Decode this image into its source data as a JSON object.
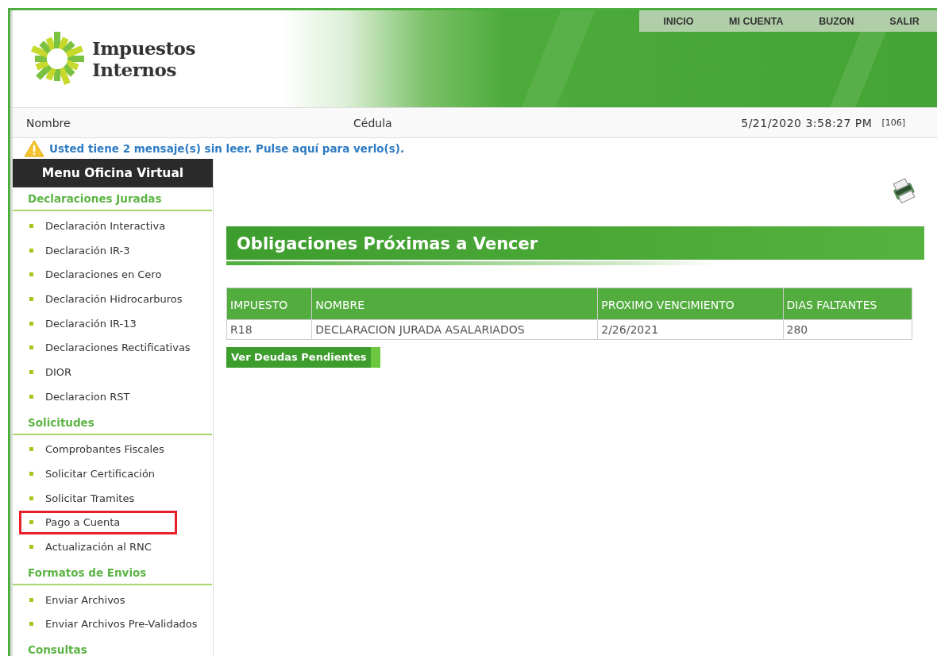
{
  "header": {
    "logo_lines": [
      "Impuestos",
      "Internos"
    ],
    "nav": [
      "INICIO",
      "MI CUENTA",
      "BUZON",
      "SALIR"
    ]
  },
  "info_bar": {
    "name_label": "Nombre",
    "id_label": "Cédula",
    "datetime": "5/21/2020 3:58:27 PM",
    "code": "[106]"
  },
  "alert": "Usted tiene 2 mensaje(s) sin leer. Pulse aquí para verlo(s).",
  "sidebar": {
    "title": "Menu Oficina Virtual",
    "sections": [
      {
        "title": "Declaraciones Juradas",
        "items": [
          {
            "label": "Declaración Interactiva",
            "highlighted": false
          },
          {
            "label": "Declaración IR-3",
            "highlighted": false
          },
          {
            "label": "Declaraciones en Cero",
            "highlighted": false
          },
          {
            "label": "Declaración Hidrocarburos",
            "highlighted": false
          },
          {
            "label": "Declaración IR-13",
            "highlighted": false
          },
          {
            "label": "Declaraciones Rectificativas",
            "highlighted": false
          },
          {
            "label": "DIOR",
            "highlighted": false
          },
          {
            "label": "Declaracion RST",
            "highlighted": false
          }
        ]
      },
      {
        "title": "Solicitudes",
        "items": [
          {
            "label": "Comprobantes Fiscales",
            "highlighted": false
          },
          {
            "label": "Solicitar Certificación",
            "highlighted": false
          },
          {
            "label": "Solicitar Tramites",
            "highlighted": false
          },
          {
            "label": "Pago a Cuenta",
            "highlighted": true
          },
          {
            "label": "Actualización al RNC",
            "highlighted": false
          }
        ]
      },
      {
        "title": "Formatos de Envios",
        "items": [
          {
            "label": "Enviar Archivos",
            "highlighted": false
          },
          {
            "label": "Enviar Archivos Pre-Validados",
            "highlighted": false
          }
        ]
      },
      {
        "title": "Consultas"
      }
    ]
  },
  "content": {
    "title": "Obligaciones Próximas a Vencer",
    "table": {
      "columns": [
        "IMPUESTO",
        "NOMBRE",
        "PROXIMO VENCIMIENTO",
        "DIAS FALTANTES"
      ],
      "rows": [
        [
          "R18",
          "DECLARACION JURADA ASALARIADOS",
          "2/26/2021",
          "280"
        ]
      ]
    },
    "button": "Ver Deudas Pendientes"
  }
}
